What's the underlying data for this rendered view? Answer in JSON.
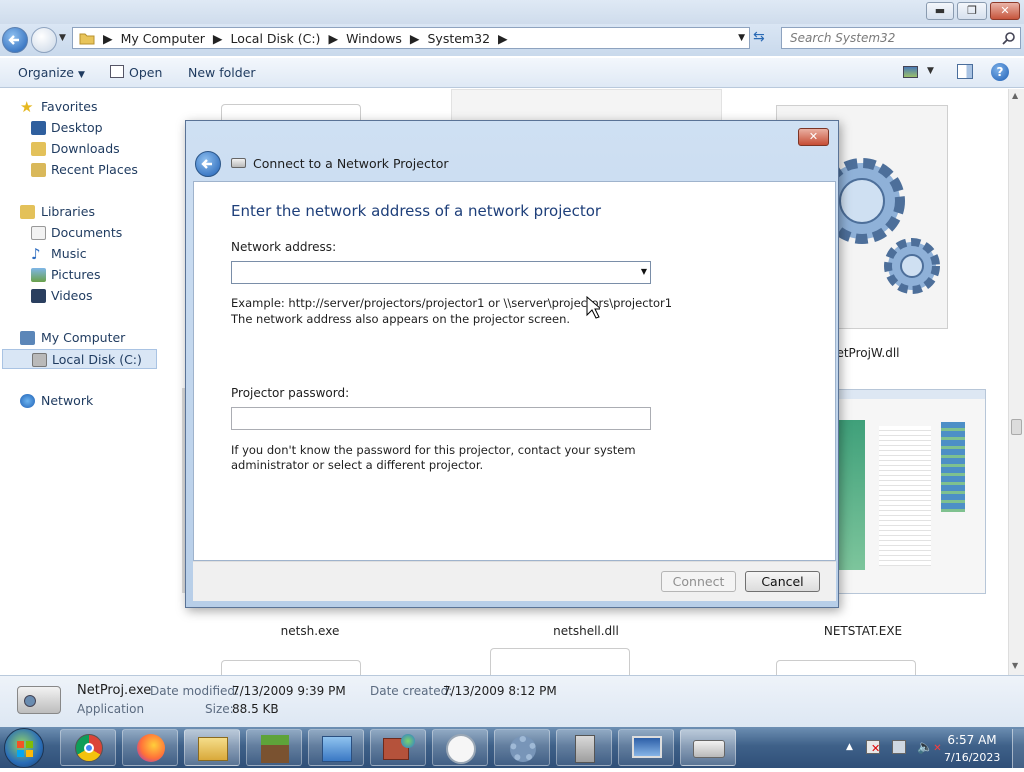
{
  "window": {
    "minimize": "▬",
    "maximize": "❐",
    "close": "✕"
  },
  "address": {
    "crumbs": [
      "My Computer",
      "Local Disk (C:)",
      "Windows",
      "System32"
    ],
    "search_placeholder": "Search System32"
  },
  "toolbar": {
    "organize": "Organize",
    "open": "Open",
    "new_folder": "New folder"
  },
  "sidebar": {
    "favorites": "Favorites",
    "desktop": "Desktop",
    "downloads": "Downloads",
    "recent": "Recent Places",
    "libraries": "Libraries",
    "documents": "Documents",
    "music": "Music",
    "pictures": "Pictures",
    "videos": "Videos",
    "computer": "My Computer",
    "local_disk": "Local Disk (C:)",
    "network": "Network"
  },
  "files": {
    "netprojw": "etProjW.dll",
    "netsh": "netsh.exe",
    "netshell": "netshell.dll",
    "netstat": "NETSTAT.EXE"
  },
  "details": {
    "name": "NetProj.exe",
    "type": "Application",
    "modified_label": "Date modified:",
    "modified": "7/13/2009 9:39 PM",
    "created_label": "Date created:",
    "created": "7/13/2009 8:12 PM",
    "size_label": "Size:",
    "size": "88.5 KB"
  },
  "dialog": {
    "title": "Connect to a Network Projector",
    "heading": "Enter the network address of a network projector",
    "address_label": "Network address:",
    "address_value": "",
    "example": "Example: http://server/projectors/projector1 or \\\\server\\projectors\\projector1",
    "hint": "The network address also appears on the projector screen.",
    "password_label": "Projector password:",
    "password_value": "",
    "password_help_1": "If you don't know the password for this projector, contact your system",
    "password_help_2": "administrator or select a different projector.",
    "connect": "Connect",
    "cancel": "Cancel"
  },
  "tray": {
    "time": "6:57 AM",
    "date": "7/16/2023"
  },
  "colors": {
    "heading": "#1e3f7a",
    "accent": "#3a6fb0"
  }
}
